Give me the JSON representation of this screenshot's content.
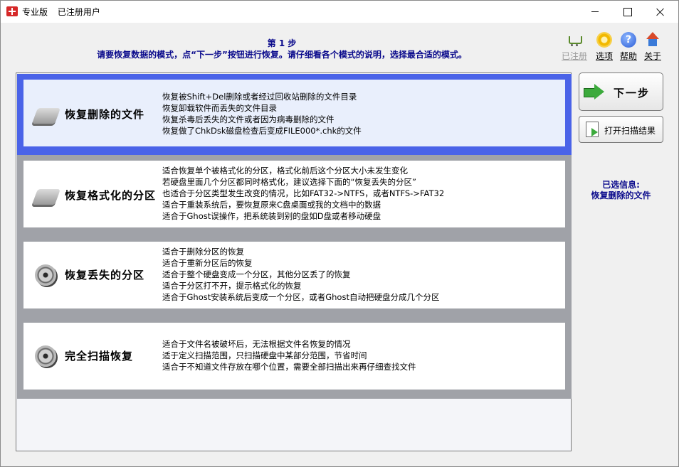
{
  "window": {
    "edition": "专业版",
    "registration": "已注册用户"
  },
  "header": {
    "step_title": "第 1 步",
    "step_description": "请要恢复数据的模式，点“下一步”按钮进行恢复。请仔细看各个模式的说明，选择最合适的模式。"
  },
  "toolbar": [
    {
      "label": "已注册",
      "icon": "cart-icon",
      "enabled": false
    },
    {
      "label": "选项",
      "icon": "gear-icon",
      "enabled": true
    },
    {
      "label": "帮助",
      "icon": "help-icon",
      "enabled": true
    },
    {
      "label": "关于",
      "icon": "house-icon",
      "enabled": true
    }
  ],
  "modes": [
    {
      "title": "恢复删除的文件",
      "selected": true,
      "icon": "disk-icon",
      "lines": [
        "恢复被Shift+Del删除或者经过回收站删除的文件目录",
        "恢复卸载软件而丢失的文件目录",
        "恢复杀毒后丢失的文件或者因为病毒删除的文件",
        "恢复做了ChkDsk磁盘检查后变成FILE000*.chk的文件"
      ]
    },
    {
      "title": "恢复格式化的分区",
      "selected": false,
      "icon": "disk-icon",
      "lines": [
        "适合恢复单个被格式化的分区，格式化前后这个分区大小未发生变化",
        "若硬盘里面几个分区都同时格式化，建议选择下面的“恢复丢失的分区”",
        "也适合于分区类型发生改变的情况，比如FAT32->NTFS，或者NTFS->FAT32",
        "适合于重装系统后，要恢复原来C盘桌面或我的文档中的数据",
        "适合于Ghost误操作，把系统装到别的盘如D盘或者移动硬盘"
      ]
    },
    {
      "title": "恢复丢失的分区",
      "selected": false,
      "icon": "hard-drive-icon",
      "lines": [
        "适合于删除分区的恢复",
        "适合于重新分区后的恢复",
        "适合于整个硬盘变成一个分区，其他分区丢了的恢复",
        "适合于分区打不开，提示格式化的恢复",
        "适合于Ghost安装系统后变成一个分区，或者Ghost自动把硬盘分成几个分区"
      ]
    },
    {
      "title": "完全扫描恢复",
      "selected": false,
      "icon": "hard-drive-icon",
      "lines": [
        "适合于文件名被破坏后，无法根据文件名恢复的情况",
        "适于定义扫描范围，只扫描硬盘中某部分范围，节省时间",
        "适合于不知道文件存放在哪个位置，需要全部扫描出来再仔细查找文件"
      ]
    }
  ],
  "actions": {
    "next_label": "下一步",
    "open_scan_label": "打开扫描结果"
  },
  "selected_info": {
    "label": "已选信息:",
    "value": "恢复删除的文件"
  }
}
